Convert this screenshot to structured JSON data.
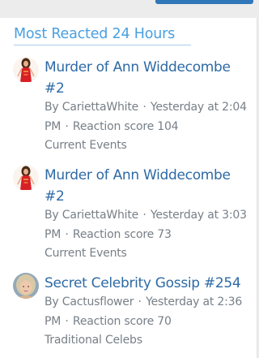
{
  "widget": {
    "title": "Most Reacted 24 Hours"
  },
  "items": [
    {
      "title": "Murder of Ann Widdecombe #2",
      "author_prefix": "By",
      "author": "CariettaWhite",
      "separator": "·",
      "date": "Yesterday at 2:04 PM",
      "reaction_score_label": "Reaction score",
      "reaction_score": "104",
      "forum": "Current Events",
      "avatar_icon": "woman-in-red-dress-avatar"
    },
    {
      "title": "Murder of Ann Widdecombe #2",
      "author_prefix": "By",
      "author": "CariettaWhite",
      "separator": "·",
      "date": "Yesterday at 3:03 PM",
      "reaction_score_label": "Reaction score",
      "reaction_score": "73",
      "forum": "Current Events",
      "avatar_icon": "woman-in-red-dress-avatar"
    },
    {
      "title": "Secret Celebrity Gossip #254",
      "author_prefix": "By",
      "author": "Cactusflower",
      "separator": "·",
      "date": "Yesterday at 2:36 PM",
      "reaction_score_label": "Reaction score",
      "reaction_score": "70",
      "forum": "Traditional Celebs",
      "avatar_icon": "blonde-woman-photo-avatar"
    }
  ],
  "colors": {
    "title": "#4aa0e1",
    "link": "#2d6aa5",
    "meta": "#777f87",
    "button": "#2f77b8"
  }
}
